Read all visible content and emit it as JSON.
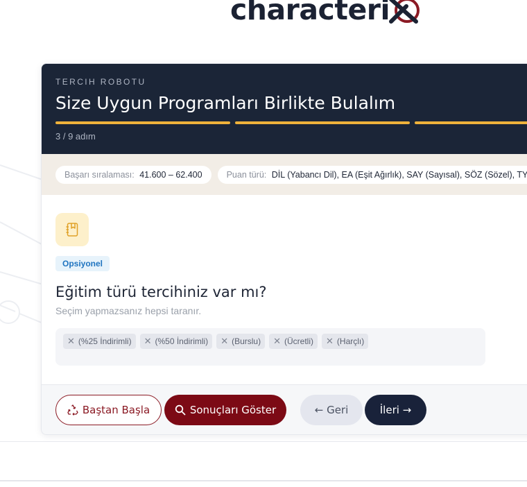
{
  "brand": {
    "logo_text": "characteri",
    "logo_mark": "X",
    "accent": "#8b1a24"
  },
  "wizard": {
    "eyebrow": "TERCIH ROBOTU",
    "title": "Size Uygun Programları Birlikte Bulalım",
    "step_text": "3 / 9 adım",
    "progress_color": "#efb23b"
  },
  "filters": [
    {
      "label": "Başarı sıralaması:",
      "value": "41.600 – 62.400"
    },
    {
      "label": "Puan türü:",
      "value": "DİL (Yabancı Dil), EA (Eşit Ağırlık), SAY (Sayısal), SÖZ (Sözel), TYT"
    }
  ],
  "question": {
    "icon": "notebook-bookmark-icon",
    "badge": "Opsiyonel",
    "title": "Eğitim türü tercihiniz var mı?",
    "hint": "Seçim yapmazsanız hepsi taranır.",
    "selected": [
      "(%25 İndirimli)",
      "(%50 İndirimli)",
      "(Burslu)",
      "(Ücretli)",
      "(Harçlı)"
    ],
    "remove_glyph": "✕"
  },
  "actions": {
    "restart": "Baştan Başla",
    "results": "Sonuçları Göster",
    "back": "← Geri",
    "next": "İleri →"
  }
}
